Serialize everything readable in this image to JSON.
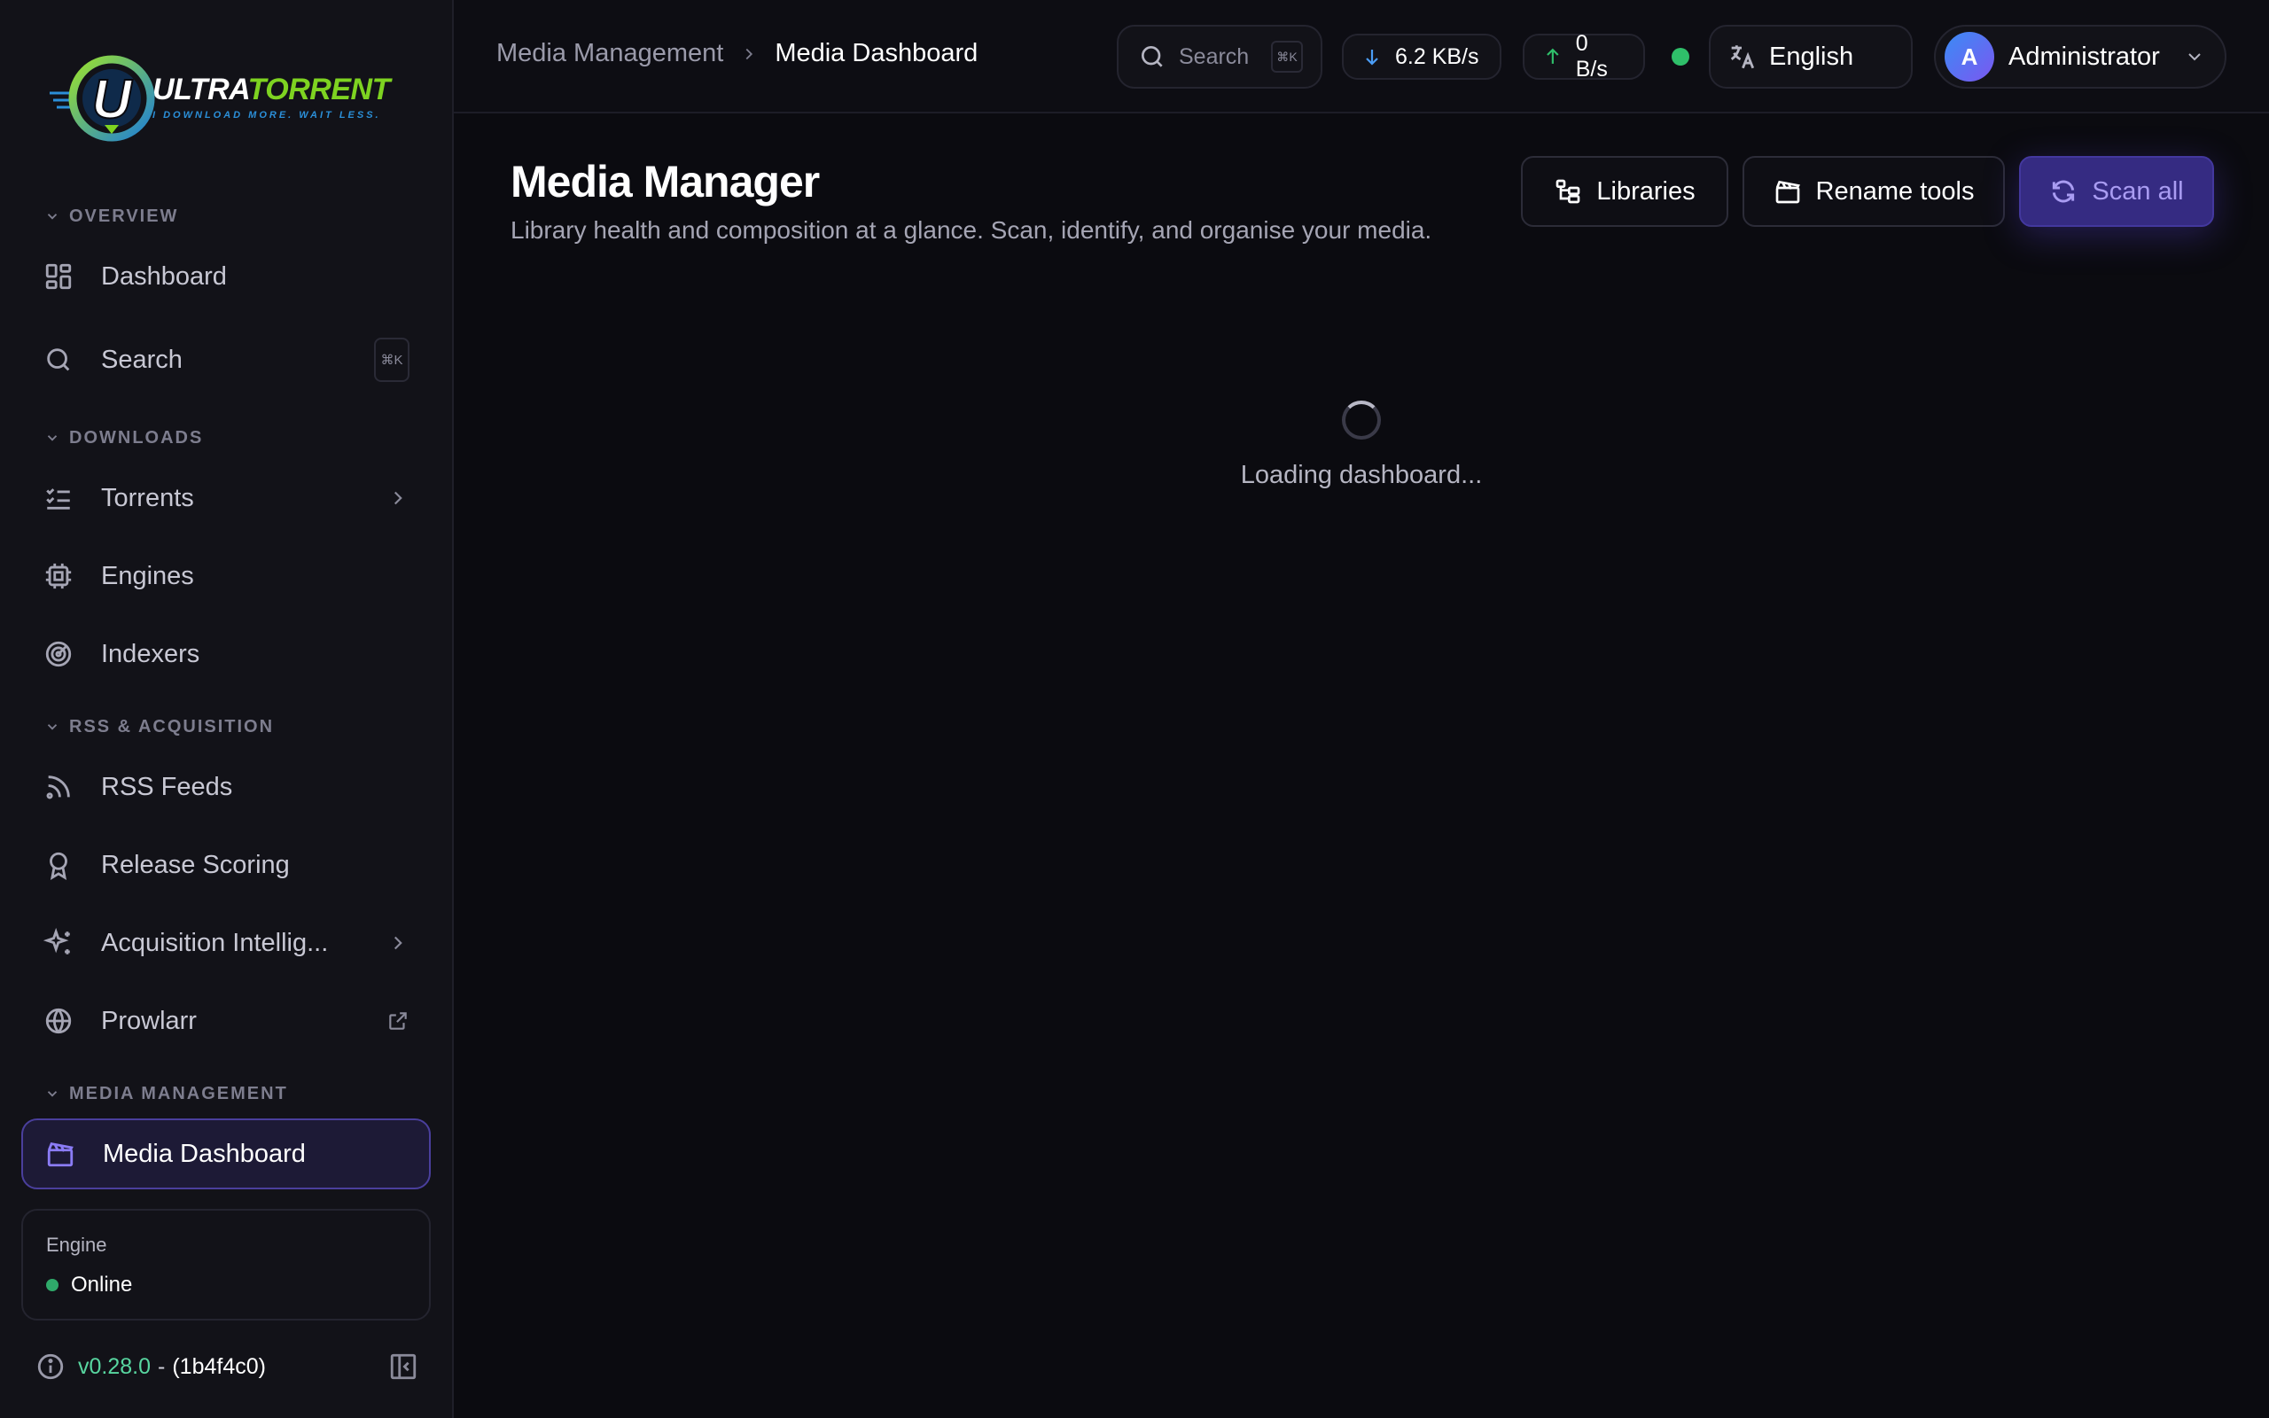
{
  "brand": {
    "word_part1": "ULTRA",
    "word_part2": "TORRENT",
    "tagline": "I DOWNLOAD MORE. WAIT LESS.",
    "logo_letter": "U"
  },
  "sidebar": {
    "sections": {
      "overview": "OVERVIEW",
      "downloads": "DOWNLOADS",
      "rss": "RSS & ACQUISITION",
      "media": "MEDIA MANAGEMENT"
    },
    "items": {
      "dashboard": "Dashboard",
      "search": "Search",
      "search_shortcut": "⌘K",
      "torrents": "Torrents",
      "engines": "Engines",
      "indexers": "Indexers",
      "rss_feeds": "RSS Feeds",
      "release_scoring": "Release Scoring",
      "acquisition": "Acquisition Intellig...",
      "prowlarr": "Prowlarr",
      "media_dashboard": "Media Dashboard"
    },
    "engine": {
      "title": "Engine",
      "status": "Online"
    },
    "version": "v0.28.0",
    "version_sep": "-",
    "commit": "(1b4f4c0)"
  },
  "topbar": {
    "breadcrumb_parent": "Media Management",
    "breadcrumb_current": "Media Dashboard",
    "search_label": "Search",
    "search_shortcut": "⌘K",
    "download_rate": "6.2 KB/s",
    "upload_rate": "0 B/s",
    "language": "English",
    "user_initial": "A",
    "user_name": "Administrator"
  },
  "main": {
    "title": "Media Manager",
    "subtitle": "Library health and composition at a glance. Scan, identify, and organise your media.",
    "buttons": {
      "libraries": "Libraries",
      "rename": "Rename tools",
      "scan": "Scan all"
    },
    "loading_text": "Loading dashboard..."
  },
  "colors": {
    "accent": "#8b7cf6",
    "online": "#2faa6a",
    "version": "#58d6a0",
    "download_arrow": "#4a9cf5",
    "upload_arrow": "#2fbf6a"
  }
}
